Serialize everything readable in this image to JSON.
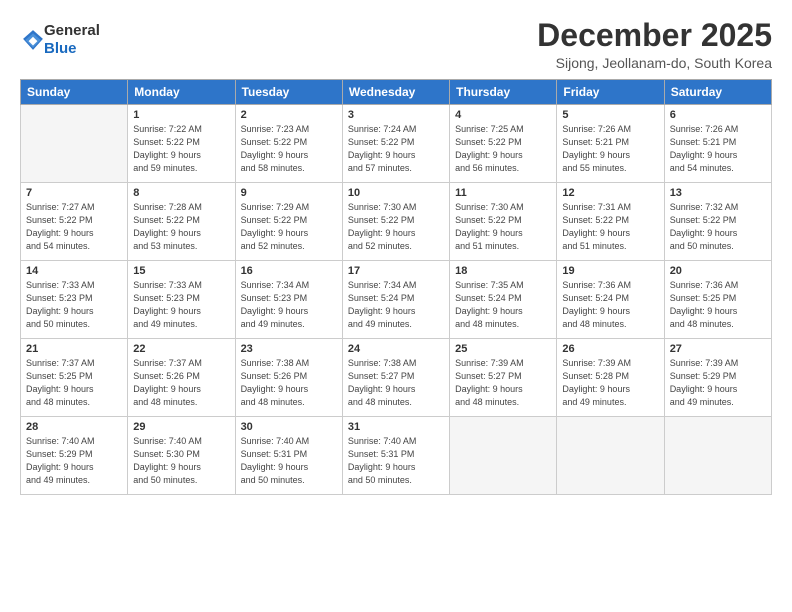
{
  "logo": {
    "text_general": "General",
    "text_blue": "Blue"
  },
  "title": "December 2025",
  "subtitle": "Sijong, Jeollanam-do, South Korea",
  "headers": [
    "Sunday",
    "Monday",
    "Tuesday",
    "Wednesday",
    "Thursday",
    "Friday",
    "Saturday"
  ],
  "weeks": [
    [
      {
        "day": "",
        "info": ""
      },
      {
        "day": "1",
        "info": "Sunrise: 7:22 AM\nSunset: 5:22 PM\nDaylight: 9 hours\nand 59 minutes."
      },
      {
        "day": "2",
        "info": "Sunrise: 7:23 AM\nSunset: 5:22 PM\nDaylight: 9 hours\nand 58 minutes."
      },
      {
        "day": "3",
        "info": "Sunrise: 7:24 AM\nSunset: 5:22 PM\nDaylight: 9 hours\nand 57 minutes."
      },
      {
        "day": "4",
        "info": "Sunrise: 7:25 AM\nSunset: 5:22 PM\nDaylight: 9 hours\nand 56 minutes."
      },
      {
        "day": "5",
        "info": "Sunrise: 7:26 AM\nSunset: 5:21 PM\nDaylight: 9 hours\nand 55 minutes."
      },
      {
        "day": "6",
        "info": "Sunrise: 7:26 AM\nSunset: 5:21 PM\nDaylight: 9 hours\nand 54 minutes."
      }
    ],
    [
      {
        "day": "7",
        "info": "Sunrise: 7:27 AM\nSunset: 5:22 PM\nDaylight: 9 hours\nand 54 minutes."
      },
      {
        "day": "8",
        "info": "Sunrise: 7:28 AM\nSunset: 5:22 PM\nDaylight: 9 hours\nand 53 minutes."
      },
      {
        "day": "9",
        "info": "Sunrise: 7:29 AM\nSunset: 5:22 PM\nDaylight: 9 hours\nand 52 minutes."
      },
      {
        "day": "10",
        "info": "Sunrise: 7:30 AM\nSunset: 5:22 PM\nDaylight: 9 hours\nand 52 minutes."
      },
      {
        "day": "11",
        "info": "Sunrise: 7:30 AM\nSunset: 5:22 PM\nDaylight: 9 hours\nand 51 minutes."
      },
      {
        "day": "12",
        "info": "Sunrise: 7:31 AM\nSunset: 5:22 PM\nDaylight: 9 hours\nand 51 minutes."
      },
      {
        "day": "13",
        "info": "Sunrise: 7:32 AM\nSunset: 5:22 PM\nDaylight: 9 hours\nand 50 minutes."
      }
    ],
    [
      {
        "day": "14",
        "info": "Sunrise: 7:33 AM\nSunset: 5:23 PM\nDaylight: 9 hours\nand 50 minutes."
      },
      {
        "day": "15",
        "info": "Sunrise: 7:33 AM\nSunset: 5:23 PM\nDaylight: 9 hours\nand 49 minutes."
      },
      {
        "day": "16",
        "info": "Sunrise: 7:34 AM\nSunset: 5:23 PM\nDaylight: 9 hours\nand 49 minutes."
      },
      {
        "day": "17",
        "info": "Sunrise: 7:34 AM\nSunset: 5:24 PM\nDaylight: 9 hours\nand 49 minutes."
      },
      {
        "day": "18",
        "info": "Sunrise: 7:35 AM\nSunset: 5:24 PM\nDaylight: 9 hours\nand 48 minutes."
      },
      {
        "day": "19",
        "info": "Sunrise: 7:36 AM\nSunset: 5:24 PM\nDaylight: 9 hours\nand 48 minutes."
      },
      {
        "day": "20",
        "info": "Sunrise: 7:36 AM\nSunset: 5:25 PM\nDaylight: 9 hours\nand 48 minutes."
      }
    ],
    [
      {
        "day": "21",
        "info": "Sunrise: 7:37 AM\nSunset: 5:25 PM\nDaylight: 9 hours\nand 48 minutes."
      },
      {
        "day": "22",
        "info": "Sunrise: 7:37 AM\nSunset: 5:26 PM\nDaylight: 9 hours\nand 48 minutes."
      },
      {
        "day": "23",
        "info": "Sunrise: 7:38 AM\nSunset: 5:26 PM\nDaylight: 9 hours\nand 48 minutes."
      },
      {
        "day": "24",
        "info": "Sunrise: 7:38 AM\nSunset: 5:27 PM\nDaylight: 9 hours\nand 48 minutes."
      },
      {
        "day": "25",
        "info": "Sunrise: 7:39 AM\nSunset: 5:27 PM\nDaylight: 9 hours\nand 48 minutes."
      },
      {
        "day": "26",
        "info": "Sunrise: 7:39 AM\nSunset: 5:28 PM\nDaylight: 9 hours\nand 49 minutes."
      },
      {
        "day": "27",
        "info": "Sunrise: 7:39 AM\nSunset: 5:29 PM\nDaylight: 9 hours\nand 49 minutes."
      }
    ],
    [
      {
        "day": "28",
        "info": "Sunrise: 7:40 AM\nSunset: 5:29 PM\nDaylight: 9 hours\nand 49 minutes."
      },
      {
        "day": "29",
        "info": "Sunrise: 7:40 AM\nSunset: 5:30 PM\nDaylight: 9 hours\nand 50 minutes."
      },
      {
        "day": "30",
        "info": "Sunrise: 7:40 AM\nSunset: 5:31 PM\nDaylight: 9 hours\nand 50 minutes."
      },
      {
        "day": "31",
        "info": "Sunrise: 7:40 AM\nSunset: 5:31 PM\nDaylight: 9 hours\nand 50 minutes."
      },
      {
        "day": "",
        "info": ""
      },
      {
        "day": "",
        "info": ""
      },
      {
        "day": "",
        "info": ""
      }
    ]
  ]
}
